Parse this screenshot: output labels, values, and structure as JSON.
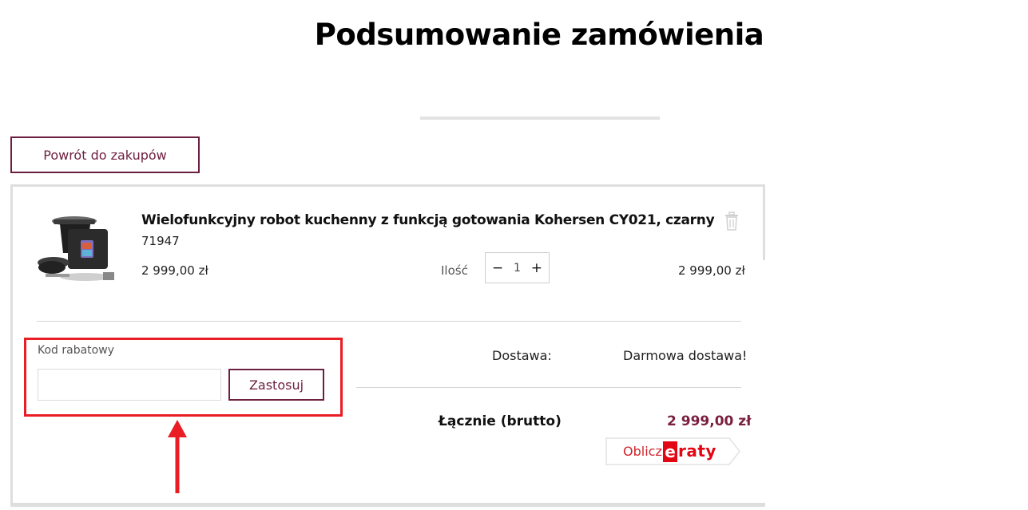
{
  "page": {
    "title": "Podsumowanie zamówienia"
  },
  "navigation": {
    "back_label": "Powrót do zakupów"
  },
  "cart": {
    "item": {
      "name": "Wielofunkcyjny robot kuchenny z funkcją gotowania Kohersen CY021, czarny",
      "sku": "71947",
      "unit_price": "2 999,00 zł",
      "quantity_label": "Ilość",
      "quantity": "1",
      "decrement": "−",
      "increment": "+",
      "line_total": "2 999,00 zł",
      "image_icon": "kitchen-robot-image",
      "delete_icon": "trash-icon"
    }
  },
  "discount": {
    "label": "Kod rabatowy",
    "input_value": "",
    "input_placeholder": "",
    "apply_label": "Zastosuj"
  },
  "summary": {
    "shipping_label": "Dostawa:",
    "shipping_value": "Darmowa dostawa!",
    "total_label": "Łącznie (brutto)",
    "total_value": "2 999,00 zł"
  },
  "installments": {
    "prefix": "Oblicz",
    "brand_e": "e",
    "brand_rest": "raty"
  },
  "colors": {
    "brand": "#6d1f3f",
    "total": "#7a1f3f",
    "highlight": "#ea1c24",
    "eraty": "#e30613"
  }
}
